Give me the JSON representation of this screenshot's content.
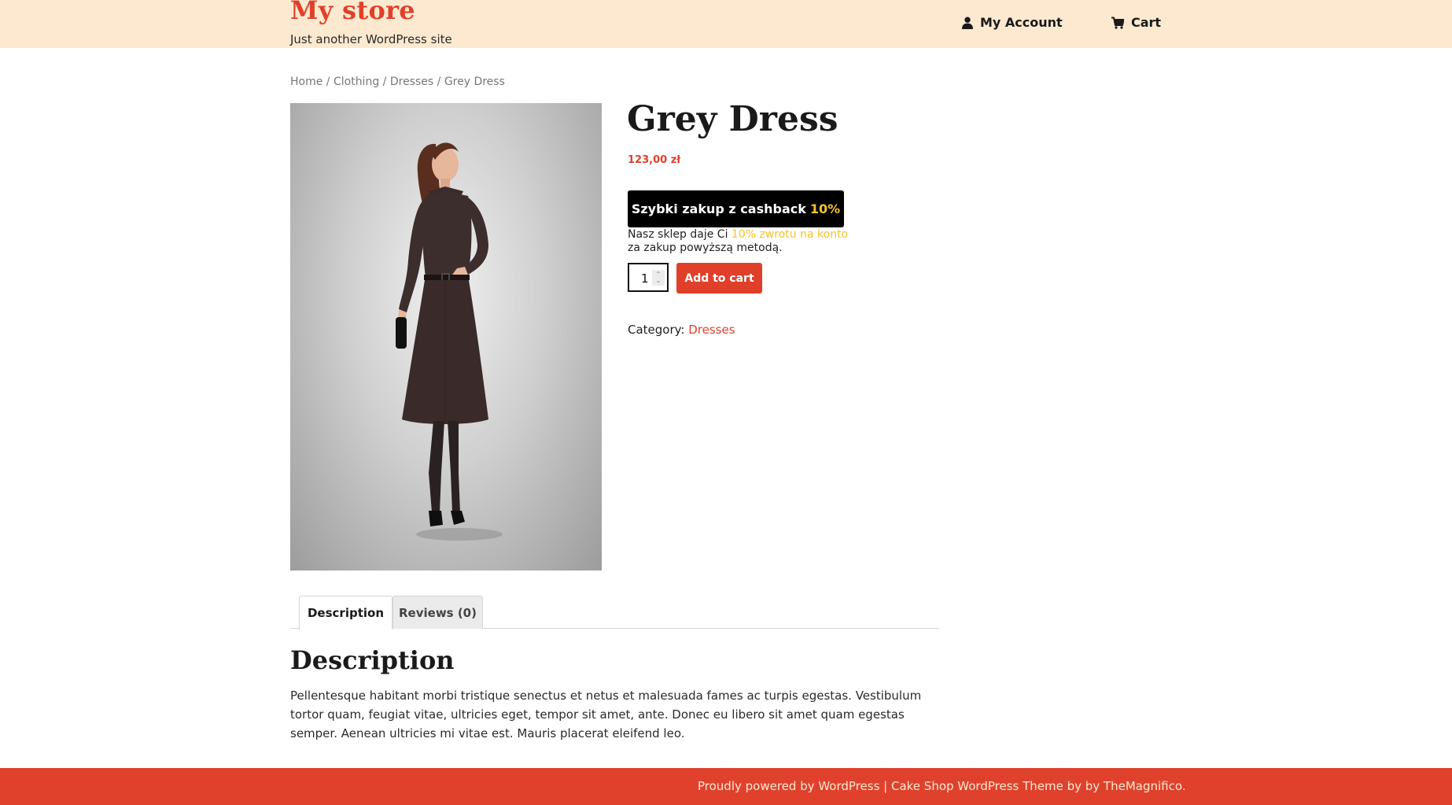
{
  "header": {
    "site_title": "My store",
    "tagline": "Just another WordPress site",
    "nav": {
      "account_label": "My Account",
      "account_icon": "user-icon",
      "cart_label": "Cart",
      "cart_icon": "cart-icon"
    }
  },
  "breadcrumb": {
    "home": "Home",
    "sep1": " / ",
    "clothing": "Clothing",
    "sep2": " / ",
    "dresses": "Dresses",
    "sep3": " / ",
    "current": "Grey Dress"
  },
  "product": {
    "image_alt": "Grey Dress",
    "title": "Grey Dress",
    "price": "123,00 zł",
    "cashback_button": {
      "label": "Szybki zakup z cashback",
      "percent": "10%"
    },
    "cashback_note": {
      "prefix": "Nasz sklep daje Ci ",
      "highlight": "10% zwrotu na konto",
      "line2": "za zakup powyższą metodą."
    },
    "quantity": "1",
    "add_to_cart_label": "Add to cart",
    "category_label": "Category: ",
    "category_value": "Dresses"
  },
  "tabs": [
    {
      "label": "Description",
      "active": true
    },
    {
      "label": "Reviews (0)",
      "active": false
    }
  ],
  "description": {
    "heading": "Description",
    "body": "Pellentesque habitant morbi tristique senectus et netus et malesuada fames ac turpis egestas. Vestibulum tortor quam, feugiat vitae, ultricies eget, tempor sit amet, ante. Donec eu libero sit amet quam egestas semper. Aenean ultricies mi vitae est. Mauris placerat eleifend leo."
  },
  "footer": {
    "powered_text": "Proudly powered by WordPress",
    "separator": " |  ",
    "theme_text": "Cake Shop WordPress Theme by by TheMagnifico."
  },
  "colors": {
    "header_bg": "#fde9cf",
    "brand_red": "#e0402a",
    "cashback_yellow": "#f6c22a",
    "footer_bg": "#df412d"
  }
}
